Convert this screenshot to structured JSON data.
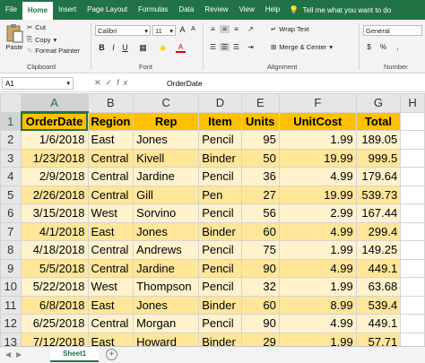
{
  "ribbon_tabs": [
    "File",
    "Home",
    "Insert",
    "Page Layout",
    "Formulas",
    "Data",
    "Review",
    "View",
    "Help"
  ],
  "tell_me": "Tell me what you want to do",
  "clipboard": {
    "paste": "Paste",
    "cut": "Cut",
    "copy": "Copy",
    "format_painter": "Format Painter",
    "group": "Clipboard"
  },
  "font": {
    "name": "Calibri",
    "size": "11",
    "group": "Font"
  },
  "alignment": {
    "wrap_text": "Wrap Text",
    "merge_center": "Merge & Center",
    "group": "Alignment"
  },
  "number": {
    "format": "General",
    "group": "Number"
  },
  "formula_bar": {
    "name_box": "A1",
    "value": "OrderDate"
  },
  "columns": [
    "A",
    "B",
    "C",
    "D",
    "E",
    "F",
    "G",
    "H"
  ],
  "rows": [
    "1",
    "2",
    "3",
    "4",
    "5",
    "6",
    "7",
    "8",
    "9",
    "10",
    "11",
    "12",
    "13",
    "14"
  ],
  "headers": [
    "OrderDate",
    "Region",
    "Rep",
    "Item",
    "Units",
    "UnitCost",
    "Total"
  ],
  "data": [
    [
      "1/6/2018",
      "East",
      "Jones",
      "Pencil",
      "95",
      "1.99",
      "189.05"
    ],
    [
      "1/23/2018",
      "Central",
      "Kivell",
      "Binder",
      "50",
      "19.99",
      "999.5"
    ],
    [
      "2/9/2018",
      "Central",
      "Jardine",
      "Pencil",
      "36",
      "4.99",
      "179.64"
    ],
    [
      "2/26/2018",
      "Central",
      "Gill",
      "Pen",
      "27",
      "19.99",
      "539.73"
    ],
    [
      "3/15/2018",
      "West",
      "Sorvino",
      "Pencil",
      "56",
      "2.99",
      "167.44"
    ],
    [
      "4/1/2018",
      "East",
      "Jones",
      "Binder",
      "60",
      "4.99",
      "299.4"
    ],
    [
      "4/18/2018",
      "Central",
      "Andrews",
      "Pencil",
      "75",
      "1.99",
      "149.25"
    ],
    [
      "5/5/2018",
      "Central",
      "Jardine",
      "Pencil",
      "90",
      "4.99",
      "449.1"
    ],
    [
      "5/22/2018",
      "West",
      "Thompson",
      "Pencil",
      "32",
      "1.99",
      "63.68"
    ],
    [
      "6/8/2018",
      "East",
      "Jones",
      "Binder",
      "60",
      "8.99",
      "539.4"
    ],
    [
      "6/25/2018",
      "Central",
      "Morgan",
      "Pencil",
      "90",
      "4.99",
      "449.1"
    ],
    [
      "7/12/2018",
      "East",
      "Howard",
      "Binder",
      "29",
      "1.99",
      "57.71"
    ]
  ],
  "sheet_tab": "Sheet1",
  "colors": {
    "excel_green": "#217346",
    "header_fill": "#ffc000",
    "band_light": "#fff2cc",
    "band_dark": "#ffe699"
  }
}
